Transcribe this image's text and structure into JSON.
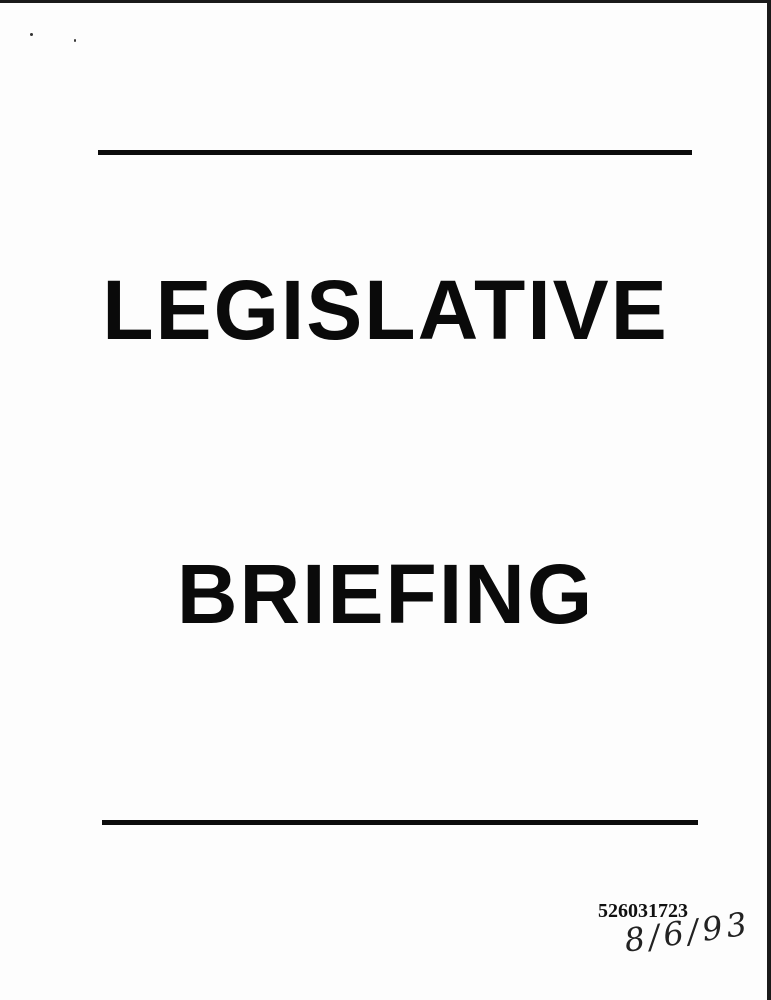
{
  "document": {
    "title_line_1": "LEGISLATIVE",
    "title_line_2": "BRIEFING",
    "document_number": "526031723",
    "handwritten_date": "8/6/93"
  },
  "colors": {
    "ink": "#0a0a0a",
    "paper": "#fdfdfd"
  }
}
